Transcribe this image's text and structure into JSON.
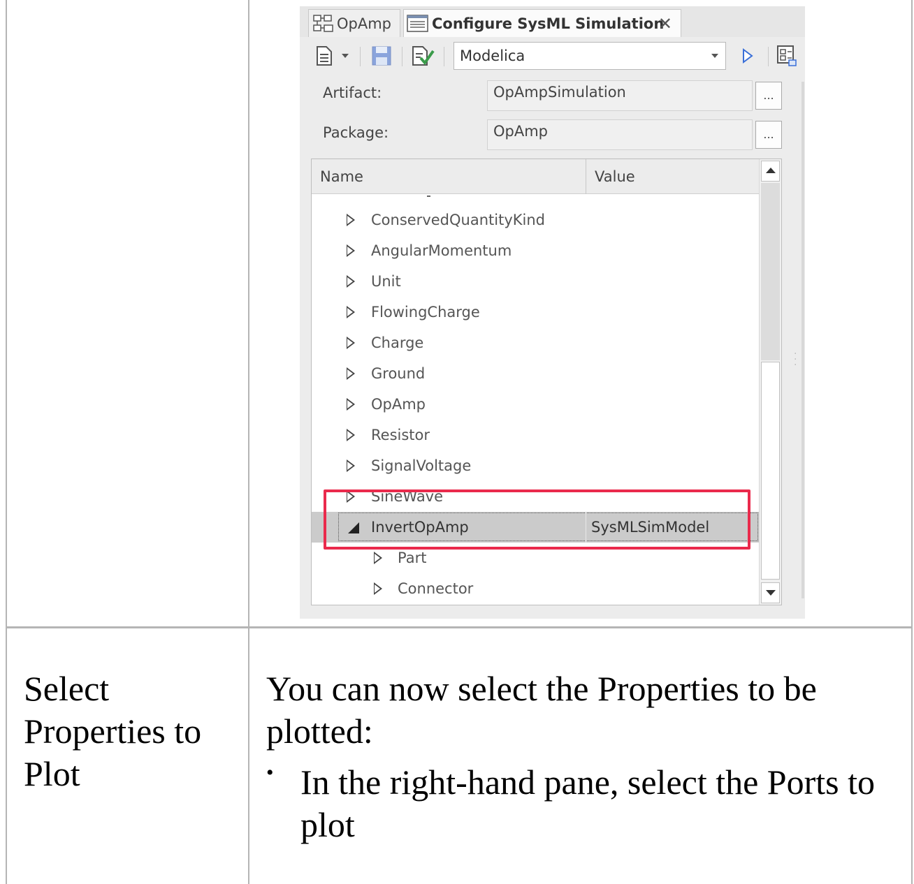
{
  "window": {
    "tabs": [
      {
        "label": "OpAmp",
        "icon": "diagram-icon",
        "active": false
      },
      {
        "label": "Configure SysML Simulation",
        "icon": "form-icon",
        "active": true
      }
    ],
    "close_glyph": "✕"
  },
  "toolbar": {
    "buttons": [
      "new-document-icon",
      "dropdown-icon",
      "save-icon",
      "validate-icon",
      "run-icon",
      "export-icon"
    ],
    "platform_value": "Modelica"
  },
  "form": {
    "artifact_label": "Artifact:",
    "artifact_value": "OpAmpSimulation",
    "package_label": "Package:",
    "package_value": "OpAmp",
    "browse_label": "..."
  },
  "grid": {
    "columns": [
      "Name",
      "Value"
    ],
    "rows": [
      {
        "name": "ConservedQuantityKind",
        "value": "",
        "level": 1,
        "expanded": false
      },
      {
        "name": "AngularMomentum",
        "value": "",
        "level": 1,
        "expanded": false
      },
      {
        "name": "Unit",
        "value": "",
        "level": 1,
        "expanded": false
      },
      {
        "name": "FlowingCharge",
        "value": "",
        "level": 1,
        "expanded": false
      },
      {
        "name": "Charge",
        "value": "",
        "level": 1,
        "expanded": false
      },
      {
        "name": "Ground",
        "value": "",
        "level": 1,
        "expanded": false
      },
      {
        "name": "OpAmp",
        "value": "",
        "level": 1,
        "expanded": false
      },
      {
        "name": "Resistor",
        "value": "",
        "level": 1,
        "expanded": false
      },
      {
        "name": "SignalVoltage",
        "value": "",
        "level": 1,
        "expanded": false
      },
      {
        "name": "SineWave",
        "value": "",
        "level": 1,
        "expanded": false
      },
      {
        "name": "InvertOpAmp",
        "value": "SysMLSimModel",
        "level": 1,
        "expanded": true,
        "selected": true
      },
      {
        "name": "Part",
        "value": "",
        "level": 2,
        "expanded": false
      },
      {
        "name": "Connector",
        "value": "",
        "level": 2,
        "expanded": false
      }
    ],
    "highlight_color": "#ea2a4c"
  },
  "doc": {
    "step_title": "Select Properties to Plot",
    "intro": "You can now select the Properties to be plotted:",
    "bullets": [
      "In the right-hand pane, select the Ports to plot"
    ],
    "bullet_glyph": "•"
  }
}
